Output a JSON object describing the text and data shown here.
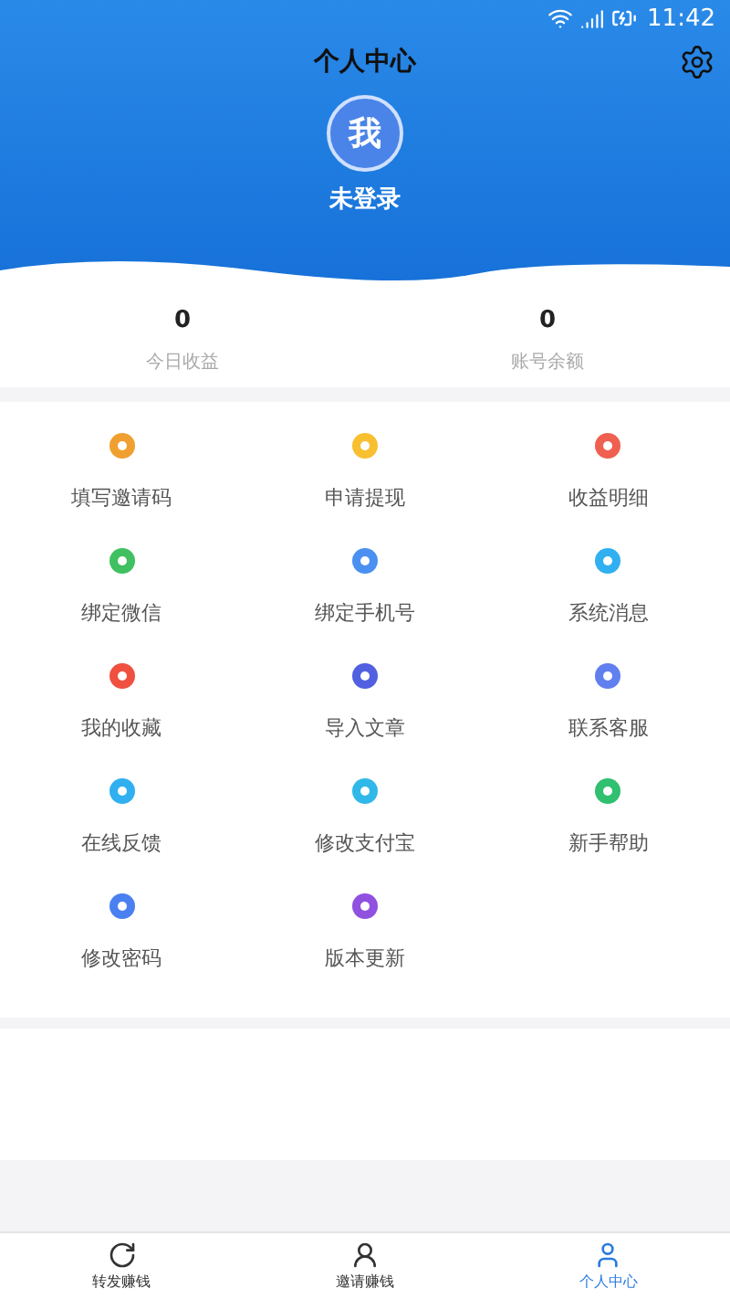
{
  "status_bar": {
    "time": "11:42"
  },
  "header": {
    "title": "个人中心",
    "avatar_text": "我",
    "user_name": "未登录"
  },
  "stats": [
    {
      "value": "0",
      "label": "今日收益"
    },
    {
      "value": "0",
      "label": "账号余额"
    }
  ],
  "menu": [
    {
      "label": "填写邀请码",
      "color": "#f0a030"
    },
    {
      "label": "申请提现",
      "color": "#f8c030"
    },
    {
      "label": "收益明细",
      "color": "#f06050"
    },
    {
      "label": "绑定微信",
      "color": "#40c060"
    },
    {
      "label": "绑定手机号",
      "color": "#4a90f0"
    },
    {
      "label": "系统消息",
      "color": "#30b0f0"
    },
    {
      "label": "我的收藏",
      "color": "#f05040"
    },
    {
      "label": "导入文章",
      "color": "#5060e0"
    },
    {
      "label": "联系客服",
      "color": "#6080f0"
    },
    {
      "label": "在线反馈",
      "color": "#30b0f0"
    },
    {
      "label": "修改支付宝",
      "color": "#30b8e8"
    },
    {
      "label": "新手帮助",
      "color": "#30c070"
    },
    {
      "label": "修改密码",
      "color": "#4a80f0"
    },
    {
      "label": "版本更新",
      "color": "#9050e0"
    }
  ],
  "tabs": [
    {
      "label": "转发赚钱",
      "kind": "share",
      "selected": false
    },
    {
      "label": "邀请赚钱",
      "kind": "invite",
      "selected": false
    },
    {
      "label": "个人中心",
      "kind": "profile",
      "selected": true
    }
  ]
}
